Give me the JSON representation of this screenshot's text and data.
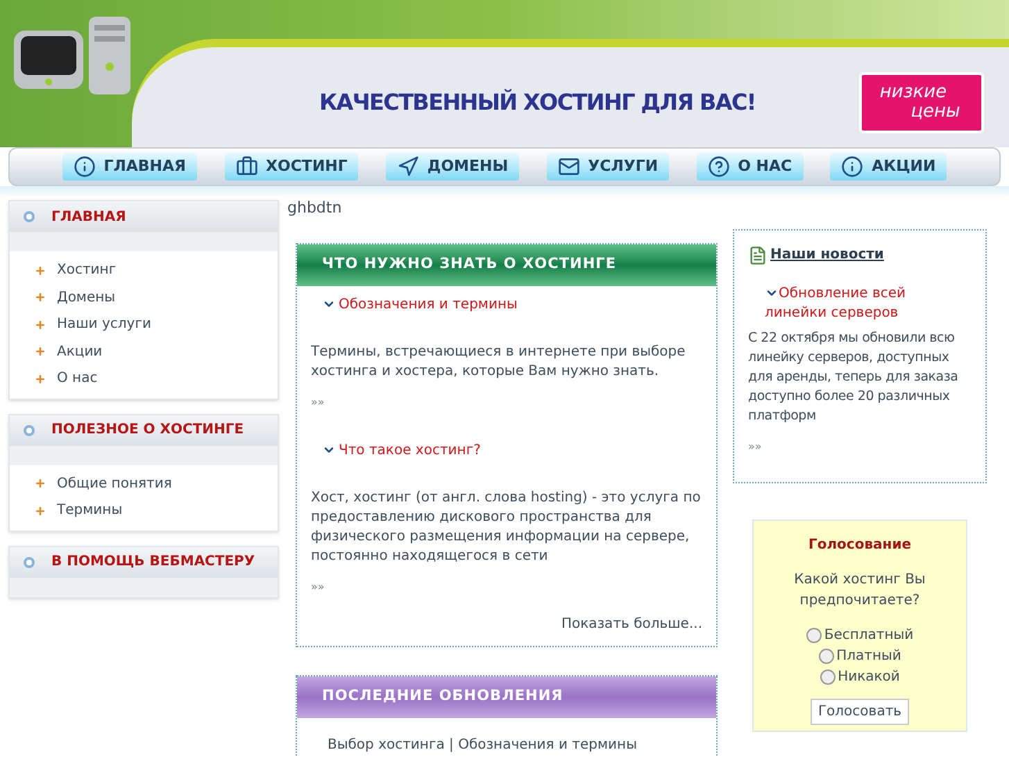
{
  "header": {
    "slogan": "КАЧЕСТВЕННЫЙ ХОСТИНГ ДЛЯ ВАС!",
    "badge": [
      "низкие",
      "цены"
    ]
  },
  "nav": [
    {
      "label": "ГЛАВНАЯ"
    },
    {
      "label": "ХОСТИНГ"
    },
    {
      "label": "ДОМЕНЫ"
    },
    {
      "label": "УСЛУГИ"
    },
    {
      "label": "О НАС"
    },
    {
      "label": "АКЦИИ"
    }
  ],
  "sidebar": [
    {
      "title": "ГЛАВНАЯ",
      "items": [
        "Хостинг",
        "Домены",
        "Наши услуги",
        "Акции",
        "О нас"
      ]
    },
    {
      "title": "ПОЛЕЗНОЕ О ХОСТИНГЕ",
      "items": [
        "Общие понятия",
        "Термины"
      ]
    },
    {
      "title": "В ПОМОЩЬ ВЕБМАСТЕРУ"
    }
  ],
  "greeting": "ghbdtn",
  "panels": [
    {
      "title": "ЧТО НУЖНО ЗНАТЬ О ХОСТИНГЕ",
      "articles": [
        {
          "title": "Обозначения и термины",
          "text": "Термины, встречающиеся в интернете при выборе хостинга и хостера, которые Вам нужно знать.",
          "more": "»»"
        },
        {
          "title": "Что такое хостинг?",
          "text": "Хост, хостинг (от англ. слова hosting) - это услуга по предоставлению дискового пространства для физического размещения информации на сервере, постоянно находящегося в сети",
          "more": "»»"
        }
      ],
      "show_more": "Показать больше..."
    },
    {
      "title": "ПОСЛЕДНИЕ ОБНОВЛЕНИЯ",
      "line": "Выбор хостинга | Обозначения и термины"
    }
  ],
  "news": {
    "title": "Наши новости",
    "items": [
      {
        "title": "Обновление всей линейки серверов",
        "text": "С 22 октября мы обновили всю линейку серверов, доступных для аренды, теперь для заказа доступно более 20 различных платформ",
        "more": "»»"
      }
    ]
  },
  "poll": {
    "title": "Голосование",
    "question": "Какой хостинг Вы предпочитаете?",
    "options": [
      {
        "label": "Бесплатный",
        "selected": false
      },
      {
        "label": "Платный",
        "selected": false
      },
      {
        "label": "Никакой",
        "selected": false
      }
    ],
    "button": "Голосовать"
  }
}
